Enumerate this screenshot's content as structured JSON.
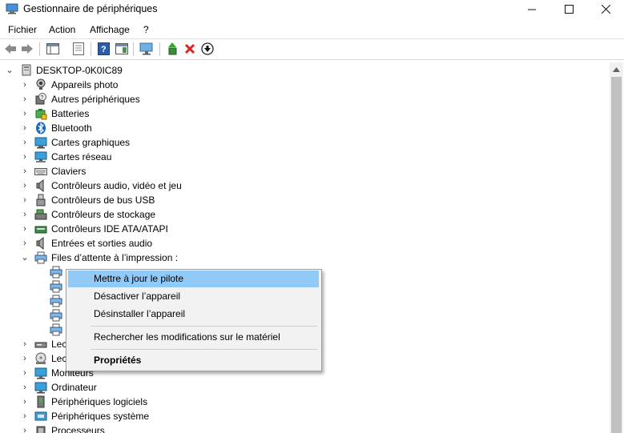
{
  "window": {
    "title": "Gestionnaire de périphériques",
    "minimize": "—",
    "maximize": "☐",
    "close": "✕"
  },
  "menu": [
    "Fichier",
    "Action",
    "Affichage",
    "?"
  ],
  "toolbar": {
    "buttons": [
      "back-arrow",
      "forward-arrow",
      "show-hide-console-tree",
      "properties",
      "help",
      "action-pane",
      "scan-hardware",
      "update-driver",
      "uninstall-device",
      "disable-device"
    ]
  },
  "tree": {
    "root": "DESKTOP-0K0IC89",
    "categories": [
      "Appareils photo",
      "Autres périphériques",
      "Batteries",
      "Bluetooth",
      "Cartes graphiques",
      "Cartes réseau",
      "Claviers",
      "Contrôleurs audio, vidéo et jeu",
      "Contrôleurs de bus USB",
      "Contrôleurs de stockage",
      "Contrôleurs IDE ATA/ATAPI",
      "Entrées et sorties audio",
      "Files d’attente à l’impression :"
    ],
    "after": [
      "Lec",
      "Lec",
      "Moniteurs",
      "Ordinateur",
      "Périphériques logiciels",
      "Périphériques système",
      "Processeurs"
    ]
  },
  "context_menu": {
    "update": "Mettre à jour le pilote",
    "disable": "Désactiver l’appareil",
    "uninstall": "Désinstaller l’appareil",
    "scan": "Rechercher les modifications sur le matériel",
    "properties": "Propriétés"
  }
}
